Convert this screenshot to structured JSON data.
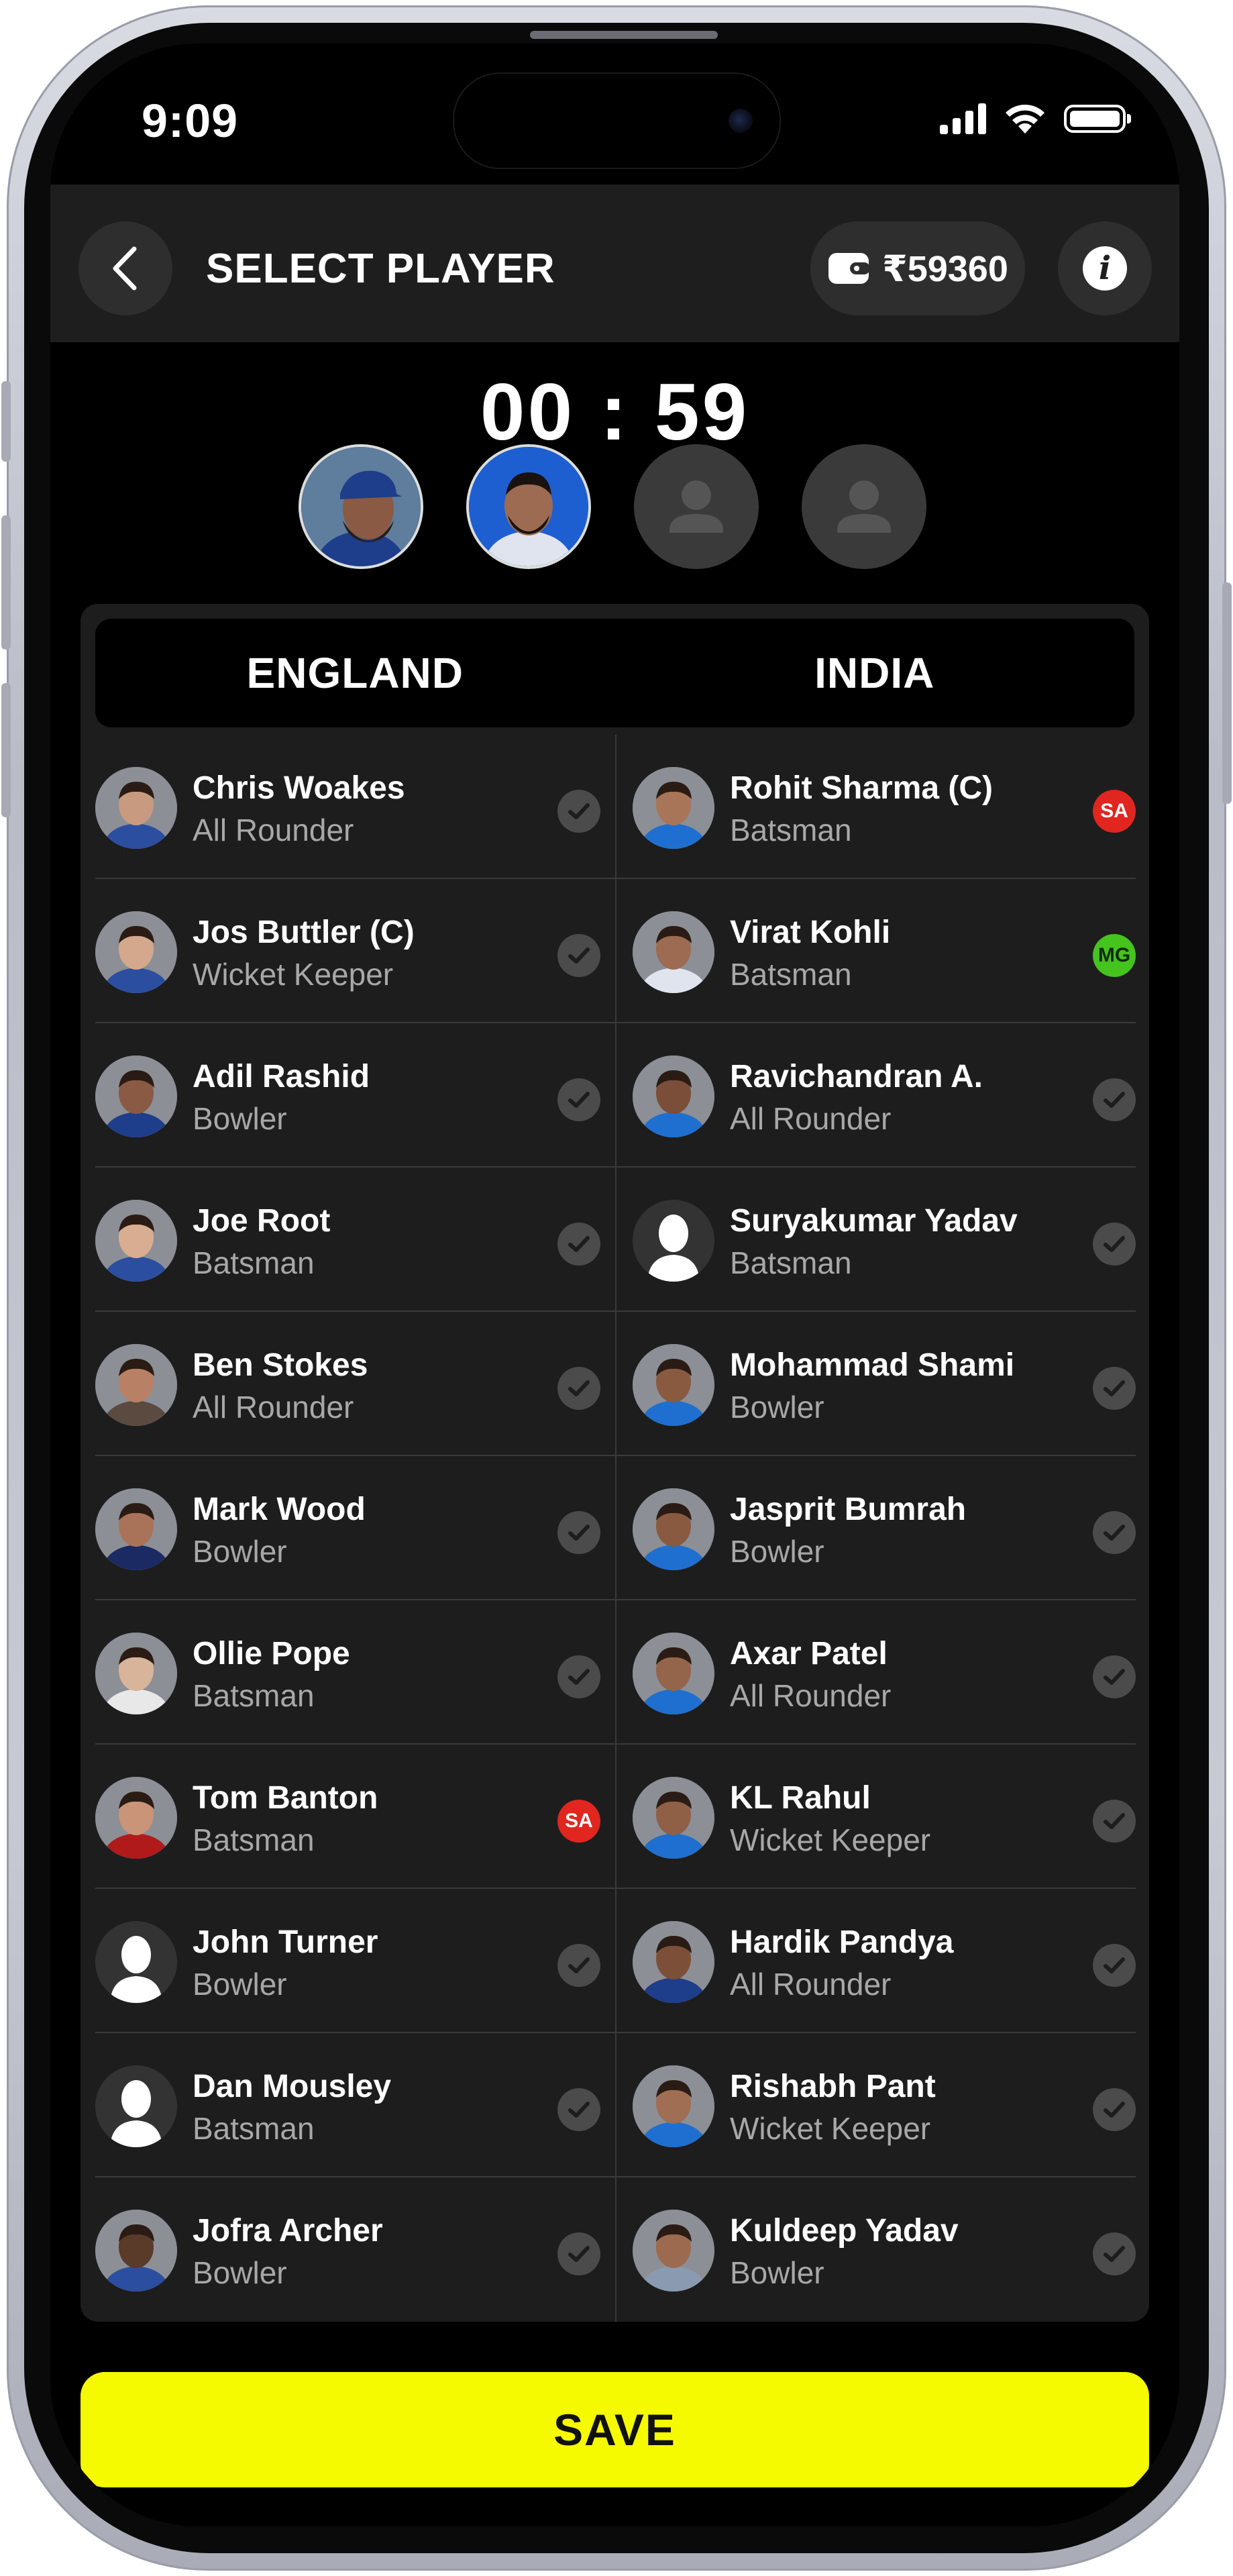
{
  "status_bar": {
    "time": "9:09"
  },
  "header": {
    "title": "SELECT PLAYER",
    "wallet_balance": "₹59360"
  },
  "timer": "00 : 59",
  "selected_slots": [
    {
      "filled": true,
      "player": "Adil Rashid"
    },
    {
      "filled": true,
      "player": "Virat Kohli"
    },
    {
      "filled": false
    },
    {
      "filled": false
    }
  ],
  "teams": {
    "left": {
      "name": "ENGLAND",
      "players": [
        {
          "name": "Chris Woakes",
          "role": "All Rounder",
          "status": "check",
          "skin": "#c89a80",
          "shirt": "#2b4ea0"
        },
        {
          "name": "Jos Buttler (C)",
          "role": "Wicket Keeper",
          "status": "check",
          "skin": "#d4a88c",
          "shirt": "#2b4ea0"
        },
        {
          "name": "Adil Rashid",
          "role": "Bowler",
          "status": "check",
          "skin": "#8a5a44",
          "shirt": "#1e3d8a"
        },
        {
          "name": "Joe Root",
          "role": "Batsman",
          "status": "check",
          "skin": "#d9ad92",
          "shirt": "#2b4ea0"
        },
        {
          "name": "Ben Stokes",
          "role": "All Rounder",
          "status": "check",
          "skin": "#b88064",
          "shirt": "#5a4a40"
        },
        {
          "name": "Mark Wood",
          "role": "Bowler",
          "status": "check",
          "skin": "#a9735a",
          "shirt": "#1b2a63"
        },
        {
          "name": "Ollie Pope",
          "role": "Batsman",
          "status": "check",
          "skin": "#d8b49a",
          "shirt": "#e8e8e8"
        },
        {
          "name": "Tom Banton",
          "role": "Batsman",
          "status": "badge",
          "badge": "SA",
          "skin": "#c99478",
          "shirt": "#b01a1a"
        },
        {
          "name": "John Turner",
          "role": "Bowler",
          "status": "check",
          "placeholder": true
        },
        {
          "name": "Dan Mousley",
          "role": "Batsman",
          "status": "check",
          "placeholder": true
        },
        {
          "name": "Jofra Archer",
          "role": "Bowler",
          "status": "check",
          "skin": "#5a3a28",
          "shirt": "#2b4ea0"
        }
      ]
    },
    "right": {
      "name": "INDIA",
      "players": [
        {
          "name": "Rohit Sharma (C)",
          "role": "Batsman",
          "status": "badge",
          "badge": "SA",
          "skin": "#a97558",
          "shirt": "#1e6fd0"
        },
        {
          "name": "Virat Kohli",
          "role": "Batsman",
          "status": "badge",
          "badge": "MG",
          "skin": "#9c6b52",
          "shirt": "#dfe4ee"
        },
        {
          "name": "Ravichandran A.",
          "role": "All Rounder",
          "status": "check",
          "skin": "#7a4e38",
          "shirt": "#1e6fd0"
        },
        {
          "name": "Suryakumar Yadav",
          "role": "Batsman",
          "status": "check",
          "placeholder": true
        },
        {
          "name": "Mohammad Shami",
          "role": "Bowler",
          "status": "check",
          "skin": "#8a5a40",
          "shirt": "#1e6fd0"
        },
        {
          "name": "Jasprit Bumrah",
          "role": "Bowler",
          "status": "check",
          "skin": "#8a5a40",
          "shirt": "#1e6fd0"
        },
        {
          "name": "Axar Patel",
          "role": "All Rounder",
          "status": "check",
          "skin": "#94654a",
          "shirt": "#1e6fd0"
        },
        {
          "name": "KL Rahul",
          "role": "Wicket Keeper",
          "status": "check",
          "skin": "#8f5f46",
          "shirt": "#1e6fd0"
        },
        {
          "name": "Hardik Pandya",
          "role": "All Rounder",
          "status": "check",
          "skin": "#7c5038",
          "shirt": "#1e3d8a"
        },
        {
          "name": "Rishabh Pant",
          "role": "Wicket Keeper",
          "status": "check",
          "skin": "#a06e52",
          "shirt": "#1e6fd0"
        },
        {
          "name": "Kuldeep Yadav",
          "role": "Bowler",
          "status": "check",
          "skin": "#9c6a4e",
          "shirt": "#8a9ab0"
        }
      ]
    }
  },
  "save_label": "SAVE",
  "colors": {
    "accent_yellow": "#f5fa00",
    "badge_red": "#e0261f",
    "badge_green": "#45c41e",
    "panel": "#1d1d1d"
  }
}
